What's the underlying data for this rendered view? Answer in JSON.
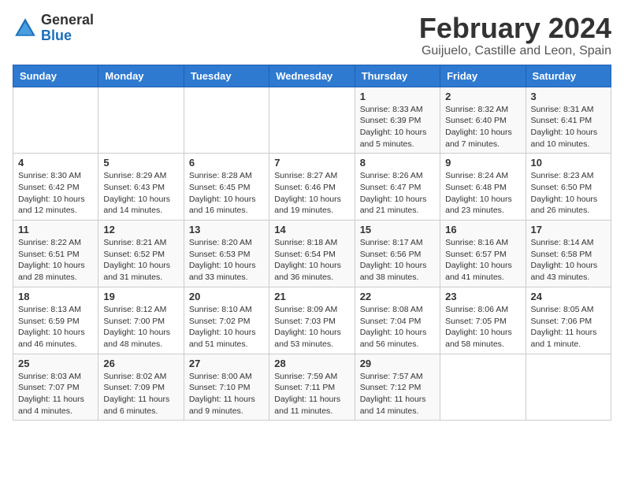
{
  "header": {
    "logo": {
      "general": "General",
      "blue": "Blue"
    },
    "title": "February 2024",
    "location": "Guijuelo, Castille and Leon, Spain"
  },
  "weekdays": [
    "Sunday",
    "Monday",
    "Tuesday",
    "Wednesday",
    "Thursday",
    "Friday",
    "Saturday"
  ],
  "weeks": [
    [
      {
        "day": "",
        "info": ""
      },
      {
        "day": "",
        "info": ""
      },
      {
        "day": "",
        "info": ""
      },
      {
        "day": "",
        "info": ""
      },
      {
        "day": "1",
        "info": "Sunrise: 8:33 AM\nSunset: 6:39 PM\nDaylight: 10 hours\nand 5 minutes."
      },
      {
        "day": "2",
        "info": "Sunrise: 8:32 AM\nSunset: 6:40 PM\nDaylight: 10 hours\nand 7 minutes."
      },
      {
        "day": "3",
        "info": "Sunrise: 8:31 AM\nSunset: 6:41 PM\nDaylight: 10 hours\nand 10 minutes."
      }
    ],
    [
      {
        "day": "4",
        "info": "Sunrise: 8:30 AM\nSunset: 6:42 PM\nDaylight: 10 hours\nand 12 minutes."
      },
      {
        "day": "5",
        "info": "Sunrise: 8:29 AM\nSunset: 6:43 PM\nDaylight: 10 hours\nand 14 minutes."
      },
      {
        "day": "6",
        "info": "Sunrise: 8:28 AM\nSunset: 6:45 PM\nDaylight: 10 hours\nand 16 minutes."
      },
      {
        "day": "7",
        "info": "Sunrise: 8:27 AM\nSunset: 6:46 PM\nDaylight: 10 hours\nand 19 minutes."
      },
      {
        "day": "8",
        "info": "Sunrise: 8:26 AM\nSunset: 6:47 PM\nDaylight: 10 hours\nand 21 minutes."
      },
      {
        "day": "9",
        "info": "Sunrise: 8:24 AM\nSunset: 6:48 PM\nDaylight: 10 hours\nand 23 minutes."
      },
      {
        "day": "10",
        "info": "Sunrise: 8:23 AM\nSunset: 6:50 PM\nDaylight: 10 hours\nand 26 minutes."
      }
    ],
    [
      {
        "day": "11",
        "info": "Sunrise: 8:22 AM\nSunset: 6:51 PM\nDaylight: 10 hours\nand 28 minutes."
      },
      {
        "day": "12",
        "info": "Sunrise: 8:21 AM\nSunset: 6:52 PM\nDaylight: 10 hours\nand 31 minutes."
      },
      {
        "day": "13",
        "info": "Sunrise: 8:20 AM\nSunset: 6:53 PM\nDaylight: 10 hours\nand 33 minutes."
      },
      {
        "day": "14",
        "info": "Sunrise: 8:18 AM\nSunset: 6:54 PM\nDaylight: 10 hours\nand 36 minutes."
      },
      {
        "day": "15",
        "info": "Sunrise: 8:17 AM\nSunset: 6:56 PM\nDaylight: 10 hours\nand 38 minutes."
      },
      {
        "day": "16",
        "info": "Sunrise: 8:16 AM\nSunset: 6:57 PM\nDaylight: 10 hours\nand 41 minutes."
      },
      {
        "day": "17",
        "info": "Sunrise: 8:14 AM\nSunset: 6:58 PM\nDaylight: 10 hours\nand 43 minutes."
      }
    ],
    [
      {
        "day": "18",
        "info": "Sunrise: 8:13 AM\nSunset: 6:59 PM\nDaylight: 10 hours\nand 46 minutes."
      },
      {
        "day": "19",
        "info": "Sunrise: 8:12 AM\nSunset: 7:00 PM\nDaylight: 10 hours\nand 48 minutes."
      },
      {
        "day": "20",
        "info": "Sunrise: 8:10 AM\nSunset: 7:02 PM\nDaylight: 10 hours\nand 51 minutes."
      },
      {
        "day": "21",
        "info": "Sunrise: 8:09 AM\nSunset: 7:03 PM\nDaylight: 10 hours\nand 53 minutes."
      },
      {
        "day": "22",
        "info": "Sunrise: 8:08 AM\nSunset: 7:04 PM\nDaylight: 10 hours\nand 56 minutes."
      },
      {
        "day": "23",
        "info": "Sunrise: 8:06 AM\nSunset: 7:05 PM\nDaylight: 10 hours\nand 58 minutes."
      },
      {
        "day": "24",
        "info": "Sunrise: 8:05 AM\nSunset: 7:06 PM\nDaylight: 11 hours\nand 1 minute."
      }
    ],
    [
      {
        "day": "25",
        "info": "Sunrise: 8:03 AM\nSunset: 7:07 PM\nDaylight: 11 hours\nand 4 minutes."
      },
      {
        "day": "26",
        "info": "Sunrise: 8:02 AM\nSunset: 7:09 PM\nDaylight: 11 hours\nand 6 minutes."
      },
      {
        "day": "27",
        "info": "Sunrise: 8:00 AM\nSunset: 7:10 PM\nDaylight: 11 hours\nand 9 minutes."
      },
      {
        "day": "28",
        "info": "Sunrise: 7:59 AM\nSunset: 7:11 PM\nDaylight: 11 hours\nand 11 minutes."
      },
      {
        "day": "29",
        "info": "Sunrise: 7:57 AM\nSunset: 7:12 PM\nDaylight: 11 hours\nand 14 minutes."
      },
      {
        "day": "",
        "info": ""
      },
      {
        "day": "",
        "info": ""
      }
    ]
  ]
}
